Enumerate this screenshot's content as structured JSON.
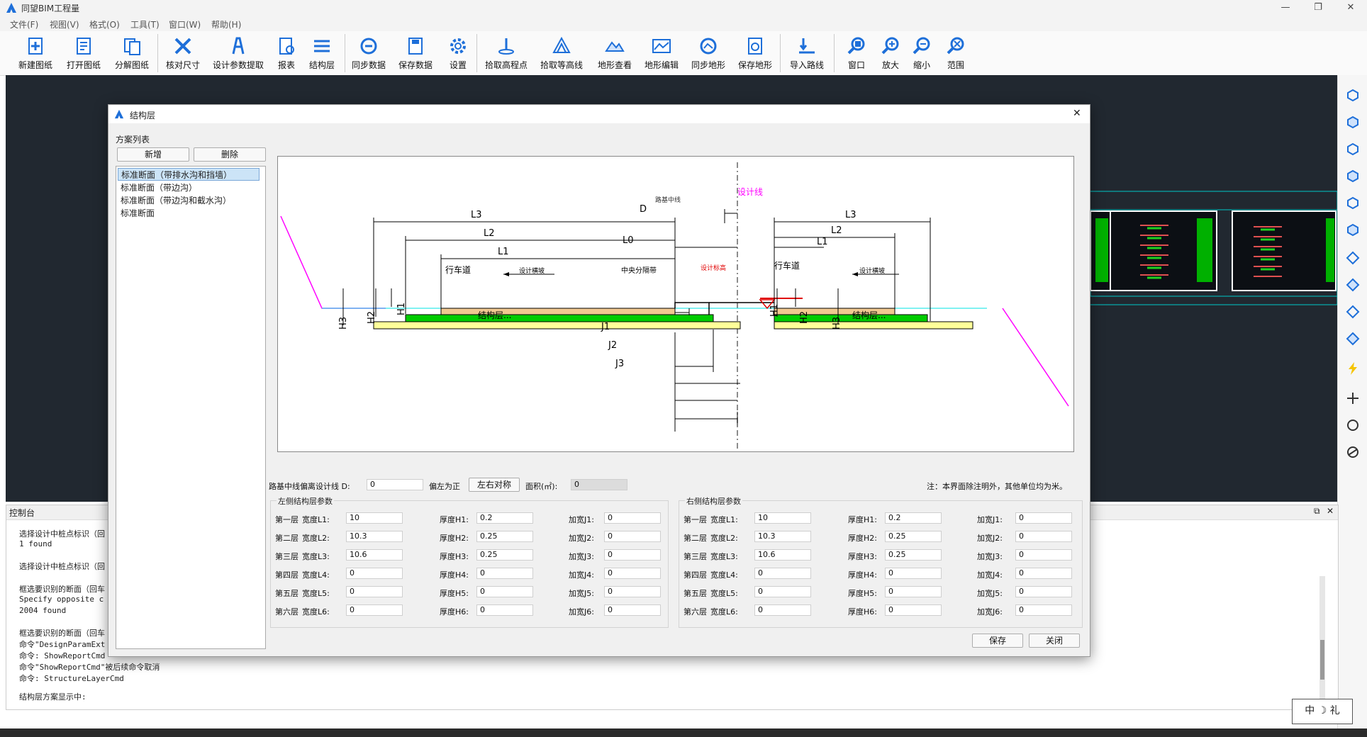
{
  "app": {
    "title": "同望BIM工程量",
    "menu": [
      "文件(F)",
      "视图(V)",
      "格式(O)",
      "工具(T)",
      "窗口(W)",
      "帮助(H)"
    ],
    "window_controls": [
      "—",
      "❐",
      "✕"
    ]
  },
  "toolbar": [
    {
      "label": "新建图纸",
      "icon": "new-drawing-icon"
    },
    {
      "label": "打开图纸",
      "icon": "open-drawing-icon"
    },
    {
      "label": "分解图纸",
      "icon": "explode-drawing-icon"
    },
    {
      "label": "核对尺寸",
      "icon": "check-dimension-icon"
    },
    {
      "label": "设计参数提取",
      "icon": "design-param-icon"
    },
    {
      "label": "报表",
      "icon": "report-icon"
    },
    {
      "label": "结构层",
      "icon": "structure-layer-icon"
    },
    {
      "label": "同步数据",
      "icon": "sync-data-icon"
    },
    {
      "label": "保存数据",
      "icon": "save-data-icon"
    },
    {
      "label": "设置",
      "icon": "settings-gear-icon"
    },
    {
      "label": "拾取高程点",
      "icon": "pick-elevation-icon"
    },
    {
      "label": "拾取等高线",
      "icon": "pick-contour-icon"
    },
    {
      "label": "地形查看",
      "icon": "terrain-view-icon"
    },
    {
      "label": "地形编辑",
      "icon": "terrain-edit-icon"
    },
    {
      "label": "同步地形",
      "icon": "sync-terrain-icon"
    },
    {
      "label": "保存地形",
      "icon": "save-terrain-icon"
    },
    {
      "label": "导入路线",
      "icon": "import-route-icon"
    },
    {
      "label": "窗口",
      "icon": "zoom-window-icon"
    },
    {
      "label": "放大",
      "icon": "zoom-in-icon"
    },
    {
      "label": "缩小",
      "icon": "zoom-out-icon"
    },
    {
      "label": "范围",
      "icon": "zoom-extent-icon"
    }
  ],
  "console": {
    "title": "控制台",
    "lines": [
      "选择设计中桩点标识（回",
      "1 found",
      "选择设计中桩点标识（回",
      "框选要识别的断面（回车",
      "Specify opposite c",
      "2004 found",
      "框选要识别的断面（回车",
      "命令\"DesignParamExt",
      "命令: ShowReportCmd",
      "命令\"ShowReportCmd\"被后续命令取消",
      "命令: StructureLayerCmd",
      "结构层方案显示中:"
    ],
    "ime": "中 ☽ 礼"
  },
  "dialog": {
    "title": "结构层",
    "scheme_list_label": "方案列表",
    "add_button": "新增",
    "delete_button": "删除",
    "schemes": [
      "标准断面（带排水沟和挡墙）",
      "标准断面（带边沟）",
      "标准断面（带边沟和截水沟）",
      "标准断面"
    ],
    "selected_scheme": 0,
    "offset_label": "路基中线偏离设计线 D:",
    "offset_value": "0",
    "left_positive": "偏左为正",
    "symmetric_button": "左右对称",
    "area_label": "面积(㎡):",
    "area_value": "0",
    "note": "注：本界面除注明外，其他单位均为米。",
    "save_button": "保存",
    "close_button": "关闭",
    "left_group": {
      "title": "左侧结构层参数",
      "rows": [
        {
          "layer": "第一层",
          "wlabel": "宽度L1:",
          "w": "10",
          "hlabel": "厚度H1:",
          "h": "0.2",
          "jlabel": "加宽J1:",
          "j": "0"
        },
        {
          "layer": "第二层",
          "wlabel": "宽度L2:",
          "w": "10.3",
          "hlabel": "厚度H2:",
          "h": "0.25",
          "jlabel": "加宽J2:",
          "j": "0"
        },
        {
          "layer": "第三层",
          "wlabel": "宽度L3:",
          "w": "10.6",
          "hlabel": "厚度H3:",
          "h": "0.25",
          "jlabel": "加宽J3:",
          "j": "0"
        },
        {
          "layer": "第四层",
          "wlabel": "宽度L4:",
          "w": "0",
          "hlabel": "厚度H4:",
          "h": "0",
          "jlabel": "加宽J4:",
          "j": "0"
        },
        {
          "layer": "第五层",
          "wlabel": "宽度L5:",
          "w": "0",
          "hlabel": "厚度H5:",
          "h": "0",
          "jlabel": "加宽J5:",
          "j": "0"
        },
        {
          "layer": "第六层",
          "wlabel": "宽度L6:",
          "w": "0",
          "hlabel": "厚度H6:",
          "h": "0",
          "jlabel": "加宽J6:",
          "j": "0"
        }
      ]
    },
    "right_group": {
      "title": "右侧结构层参数",
      "rows": [
        {
          "layer": "第一层",
          "wlabel": "宽度L1:",
          "w": "10",
          "hlabel": "厚度H1:",
          "h": "0.2",
          "jlabel": "加宽J1:",
          "j": "0"
        },
        {
          "layer": "第二层",
          "wlabel": "宽度L2:",
          "w": "10.3",
          "hlabel": "厚度H2:",
          "h": "0.25",
          "jlabel": "加宽J2:",
          "j": "0"
        },
        {
          "layer": "第三层",
          "wlabel": "宽度L3:",
          "w": "10.6",
          "hlabel": "厚度H3:",
          "h": "0.25",
          "jlabel": "加宽J3:",
          "j": "0"
        },
        {
          "layer": "第四层",
          "wlabel": "宽度L4:",
          "w": "0",
          "hlabel": "厚度H4:",
          "h": "0",
          "jlabel": "加宽J4:",
          "j": "0"
        },
        {
          "layer": "第五层",
          "wlabel": "宽度L5:",
          "w": "0",
          "hlabel": "厚度H5:",
          "h": "0",
          "jlabel": "加宽J5:",
          "j": "0"
        },
        {
          "layer": "第六层",
          "wlabel": "宽度L6:",
          "w": "0",
          "hlabel": "厚度H6:",
          "h": "0",
          "jlabel": "加宽J6:",
          "j": "0"
        }
      ]
    },
    "diagram": {
      "design_line": "设计线",
      "subgrade_centerline": "路基中线",
      "median": "中央分隔带",
      "carriageway": "行车道",
      "design_slope": "设计横坡",
      "design_elevation": "设计标高",
      "structure_layers": "结构层...",
      "labels": [
        "L1",
        "L2",
        "L3",
        "L0",
        "D",
        "J1",
        "J2",
        "J3",
        "H1",
        "H2",
        "H3"
      ]
    }
  },
  "colors": {
    "canvas_bg": "#212830",
    "layer_green": "#00cc00",
    "surface_tan": "#f0c890",
    "base_yellow": "#ffff99",
    "design_line_magenta": "#ff00ff",
    "ground_cyan": "#00e5e5"
  }
}
